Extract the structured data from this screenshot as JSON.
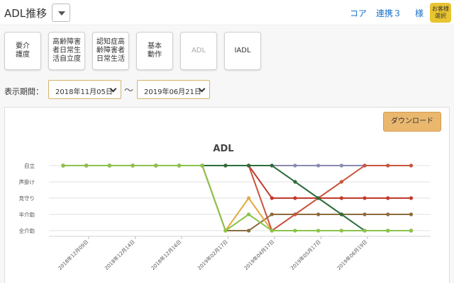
{
  "header": {
    "title": "ADL推移",
    "links": [
      "コア",
      "連携３",
      "様"
    ],
    "customer_badge": "お客様\n選択"
  },
  "menu": {
    "buttons": [
      {
        "label": "要介\n護度",
        "disabled": false
      },
      {
        "label": "高齢障害\n者日常生\n活自立度",
        "disabled": false
      },
      {
        "label": "認知症高\n齢障害者\n日常生活",
        "disabled": false
      },
      {
        "label": "基本\n動作",
        "disabled": false
      },
      {
        "label": "ADL",
        "disabled": true
      },
      {
        "label": "IADL",
        "disabled": false
      }
    ]
  },
  "period": {
    "label": "表示期間：",
    "start": "2018年11月05日",
    "separator": "～",
    "end": "2019年06月21日"
  },
  "download_label": "ダウンロード",
  "chart_data": {
    "type": "line",
    "title": "ADL",
    "y_categories": [
      "全介助",
      "半介助",
      "見守り",
      "声掛け",
      "自立"
    ],
    "x_tick_labels": [
      "2018年12月09日",
      "2018年12月14日",
      "2018年12月16日",
      "2019年02月17日",
      "2019年04月17日",
      "2019年05月17日",
      "2019年06月19日"
    ],
    "x_count": 16,
    "series": [
      {
        "color": "#8a8ab0",
        "values": [
          4,
          4,
          4,
          4,
          4,
          4,
          4,
          4,
          4,
          4,
          4,
          4,
          4,
          4,
          4,
          4
        ]
      },
      {
        "color": "#8b6b3c",
        "values": [
          4,
          4,
          4,
          4,
          4,
          4,
          4,
          0,
          0,
          1,
          1,
          1,
          1,
          1,
          1,
          1
        ]
      },
      {
        "color": "#e3a940",
        "values": [
          4,
          4,
          4,
          4,
          4,
          4,
          4,
          0,
          2,
          0,
          0,
          0,
          0,
          0,
          0,
          0
        ]
      },
      {
        "color": "#c0392b",
        "values": [
          4,
          4,
          4,
          4,
          4,
          4,
          4,
          4,
          4,
          2,
          2,
          2,
          2,
          2,
          2,
          2
        ]
      },
      {
        "color": "#c8553d",
        "values": [
          4,
          4,
          4,
          4,
          4,
          4,
          4,
          4,
          4,
          0,
          1,
          2,
          3,
          4,
          4,
          4
        ]
      },
      {
        "color": "#2e6b3a",
        "values": [
          4,
          4,
          4,
          4,
          4,
          4,
          4,
          4,
          4,
          4,
          3,
          2,
          1,
          0,
          0,
          0
        ]
      },
      {
        "color": "#8bc34a",
        "values": [
          4,
          4,
          4,
          4,
          4,
          4,
          4,
          0,
          1,
          0,
          0,
          0,
          0,
          0,
          0,
          0
        ]
      }
    ]
  }
}
